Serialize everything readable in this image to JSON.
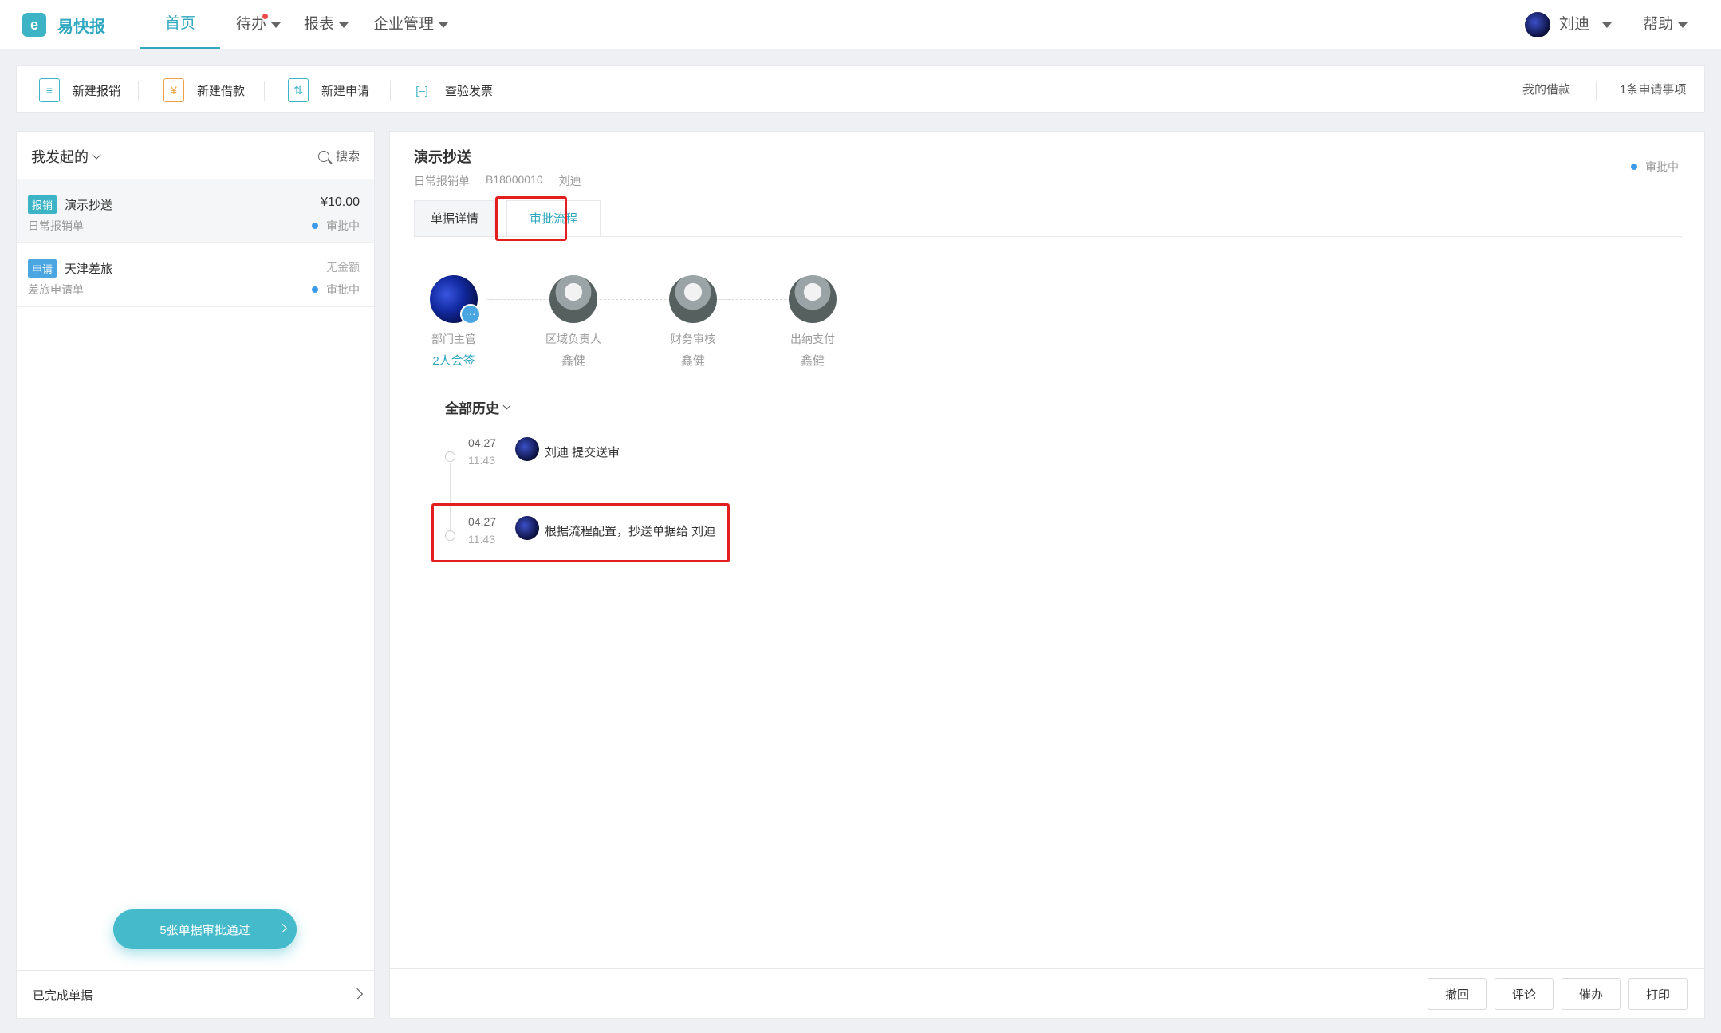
{
  "app": {
    "logo_mark": "e",
    "name": "易快报"
  },
  "nav": {
    "items": [
      {
        "label": "首页",
        "active": true
      },
      {
        "label": "待办",
        "has_dot": true,
        "has_caret": true
      },
      {
        "label": "报表",
        "has_caret": true
      },
      {
        "label": "企业管理",
        "has_caret": true
      }
    ],
    "user_name": "刘迪",
    "help": "帮助"
  },
  "toolbar": {
    "new_expense": "新建报销",
    "new_loan": "新建借款",
    "new_request": "新建申请",
    "check_invoice": "查验发票",
    "my_loans": "我的借款",
    "request_items": "1条申请事项"
  },
  "left": {
    "filter": "我发起的",
    "search": "搜索",
    "docs": [
      {
        "tag": "报销",
        "title": "演示抄送",
        "subtitle": "日常报销单",
        "amount": "¥10.00",
        "status": "审批中"
      },
      {
        "tag": "申请",
        "title": "天津差旅",
        "subtitle": "差旅申请单",
        "amount": "无金额",
        "status": "审批中"
      }
    ],
    "pass_banner": "5张单据审批通过",
    "completed": "已完成单据"
  },
  "detail": {
    "title": "演示抄送",
    "form_type": "日常报销单",
    "code": "B18000010",
    "submitter": "刘迪",
    "status": "审批中",
    "tabs": [
      "单据详情",
      "审批流程"
    ],
    "flow": [
      {
        "role": "部门主管",
        "person": "2人会签",
        "more": "···"
      },
      {
        "role": "区域负责人",
        "person": "鑫健"
      },
      {
        "role": "财务审核",
        "person": "鑫健"
      },
      {
        "role": "出纳支付",
        "person": "鑫健"
      }
    ],
    "history_title": "全部历史",
    "history": [
      {
        "date": "04.27",
        "time": "11:43",
        "text": "刘迪 提交送审"
      },
      {
        "date": "04.27",
        "time": "11:43",
        "text": "根据流程配置，抄送单据给 刘迪"
      }
    ],
    "actions": [
      "撤回",
      "评论",
      "催办",
      "打印"
    ]
  },
  "colors": {
    "accent": "#2ea7bf",
    "highlight": "#e21e1e",
    "status_dot": "#3c9be8"
  }
}
